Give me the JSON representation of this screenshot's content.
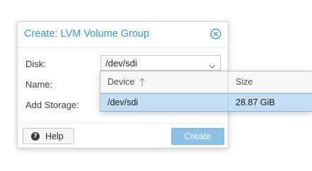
{
  "dialog": {
    "title": "Create: LVM Volume Group",
    "close_icon": "close-circle-icon",
    "accent_color": "#3892d4"
  },
  "form": {
    "disk_label": "Disk:",
    "disk_value": "/dev/sdi",
    "name_label": "Name:",
    "add_storage_label": "Add Storage:"
  },
  "dropdown": {
    "columns": [
      {
        "label": "Device",
        "sort": "ascending"
      },
      {
        "label": "Size"
      }
    ],
    "rows": [
      {
        "device": "/dev/sdi",
        "size": "28.87 GiB",
        "selected": true
      }
    ]
  },
  "footer": {
    "help_label": "Help",
    "help_icon": "question-circle-icon",
    "create_label": "Create",
    "create_color": "#8ec0e6"
  }
}
